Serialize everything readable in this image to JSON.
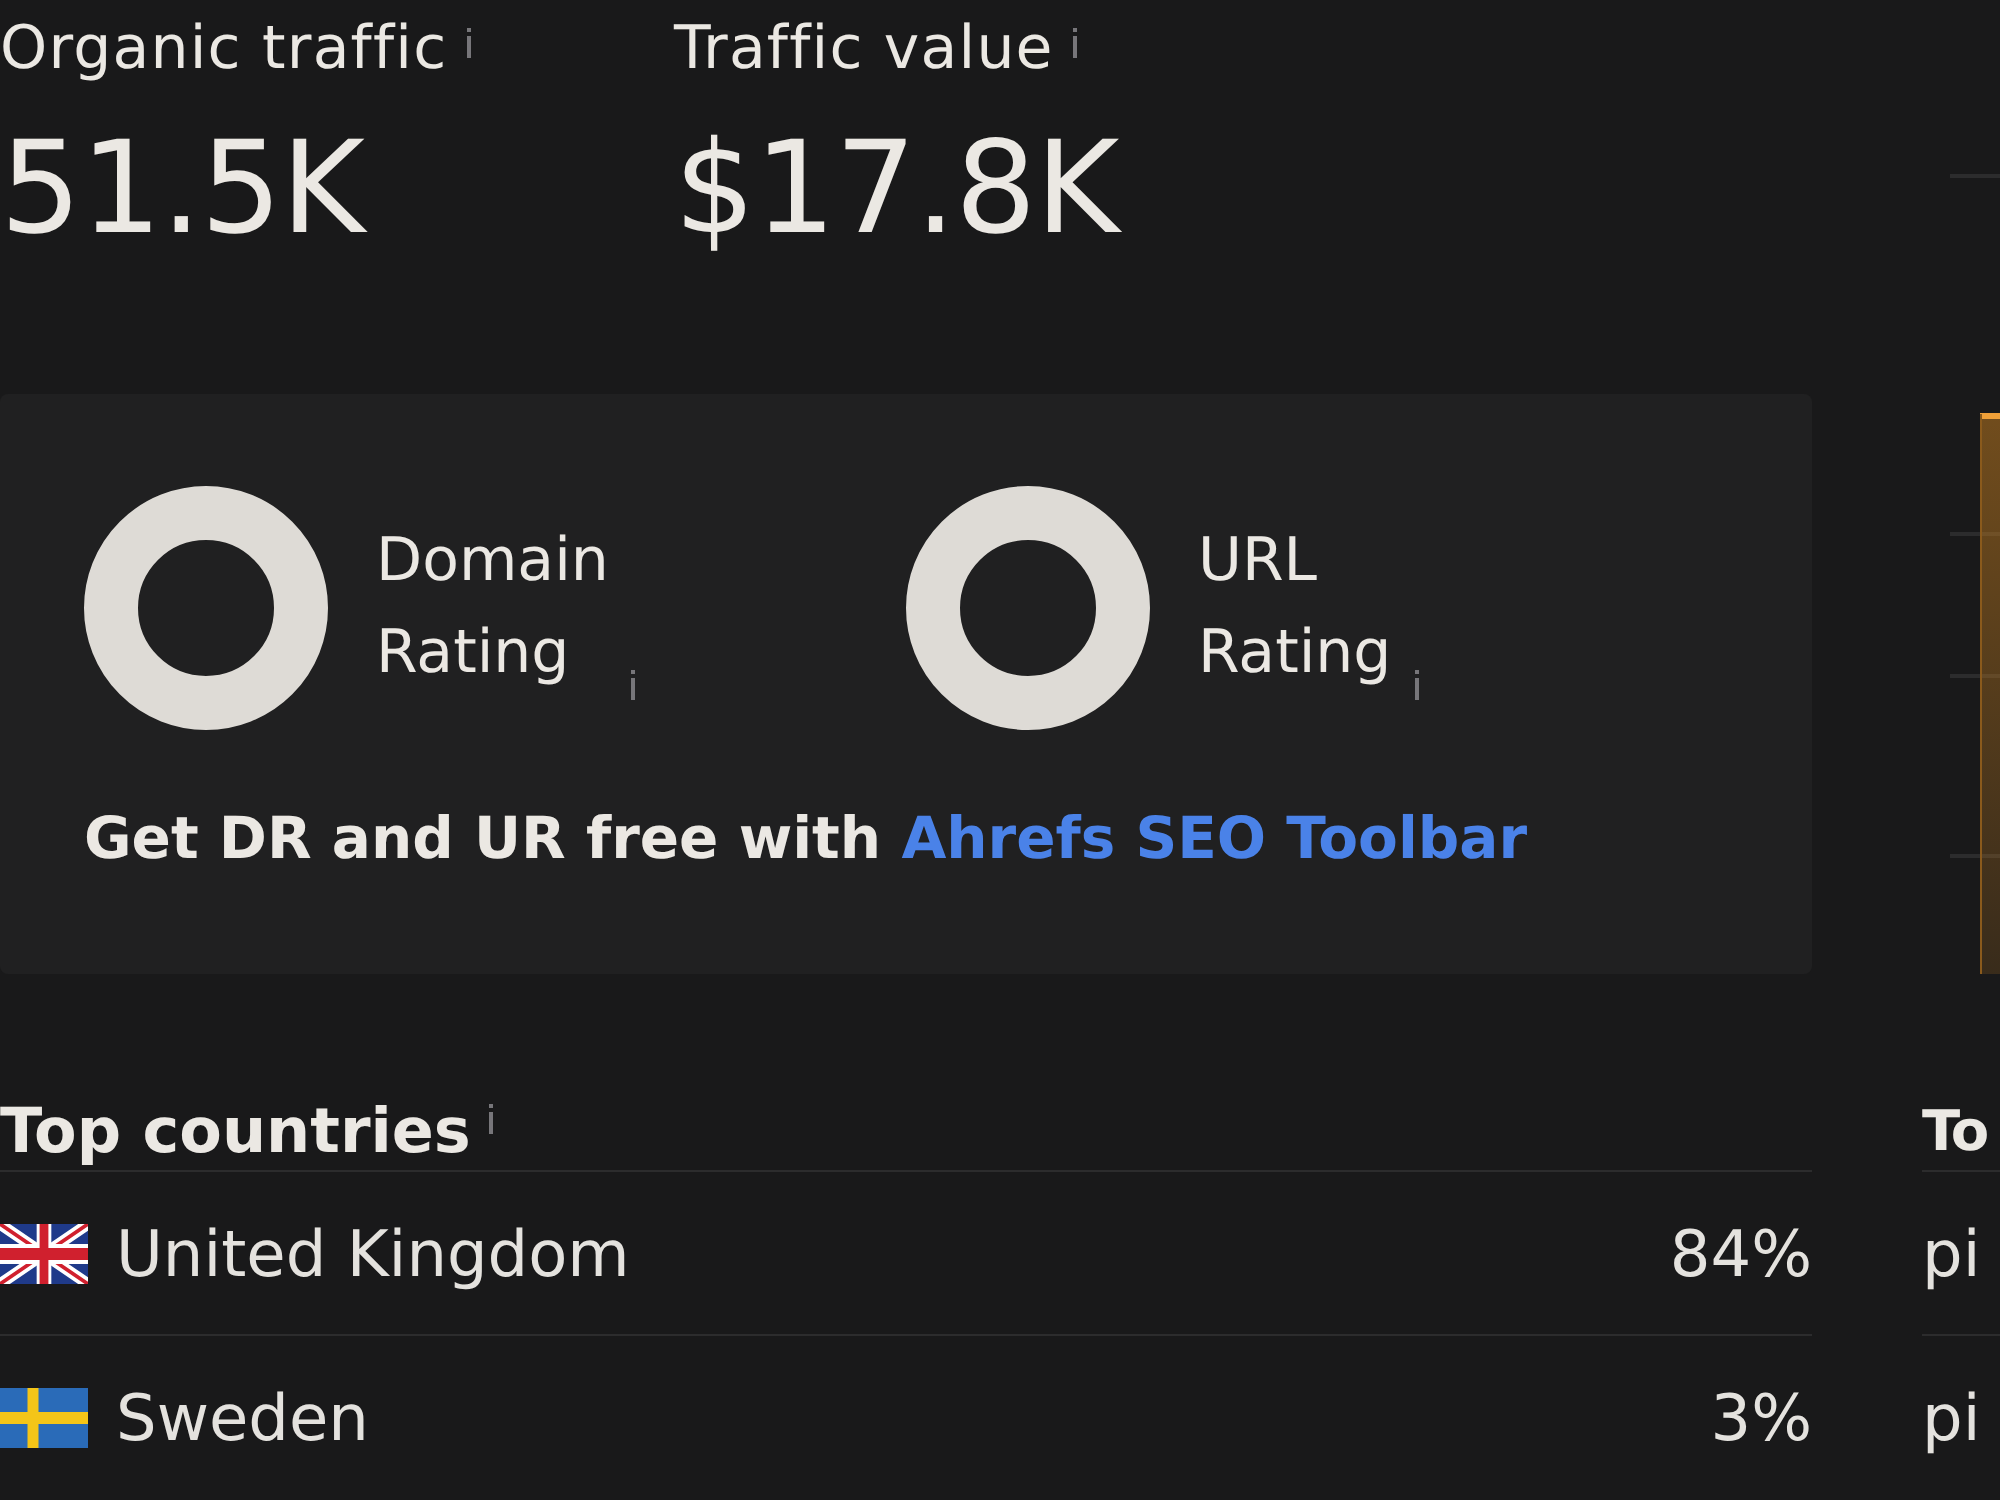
{
  "metrics": [
    {
      "label": "Organic traffic",
      "value": "51.5K"
    },
    {
      "label": "Traffic value",
      "value": "$17.8K"
    }
  ],
  "rating_panel": {
    "ratings": [
      {
        "label": "Domain Rating"
      },
      {
        "label": "URL Rating"
      }
    ],
    "promo": {
      "text": "Get DR and UR free with",
      "link": "Ahrefs SEO Toolbar"
    }
  },
  "top_countries": {
    "title": "Top countries",
    "rows": [
      {
        "kind": "uk",
        "country": "United Kingdom",
        "share": "84%"
      },
      {
        "kind": "sweden",
        "country": "Sweden",
        "share": "3%"
      }
    ]
  },
  "column_2": {
    "title": "To",
    "rows": [
      {
        "text": "pi"
      },
      {
        "text": "pi"
      }
    ]
  }
}
